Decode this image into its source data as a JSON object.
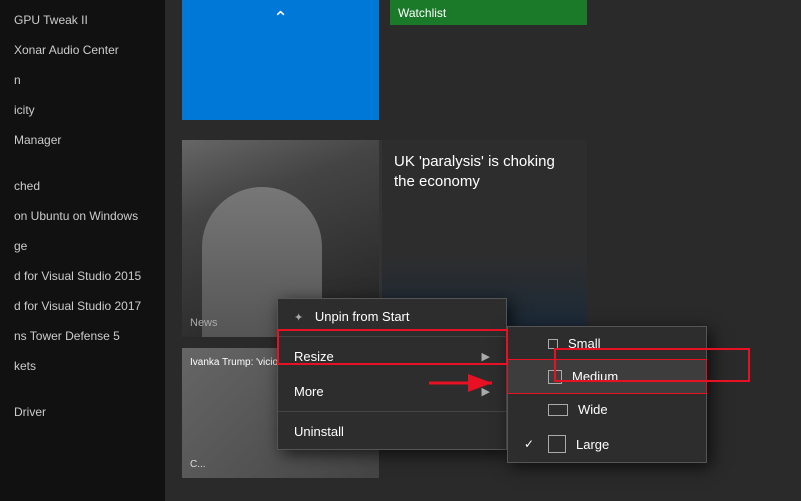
{
  "sidebar": {
    "items": [
      {
        "label": "GPU Tweak II"
      },
      {
        "label": "Xonar Audio Center"
      },
      {
        "label": "n"
      },
      {
        "label": "icity"
      },
      {
        "label": "Manager"
      },
      {
        "label": ""
      },
      {
        "label": "ched"
      },
      {
        "label": "on Ubuntu on Windows"
      },
      {
        "label": "ge"
      },
      {
        "label": "d for Visual Studio 2015"
      },
      {
        "label": "d for Visual Studio 2017"
      },
      {
        "label": "ns Tower Defense 5"
      },
      {
        "label": "kets"
      },
      {
        "label": ""
      },
      {
        "label": "Driver"
      }
    ]
  },
  "tiles": {
    "watchlist": "Watchlist",
    "news_headline": "UK 'paralysis' is choking the economy",
    "news_label": "News",
    "news2_text": "Ivanka Trump: 'viciousness tha...",
    "news2_label": "C..."
  },
  "context_menu": {
    "unpin_label": "Unpin from Start",
    "resize_label": "Resize",
    "more_label": "More",
    "uninstall_label": "Uninstall"
  },
  "resize_submenu": {
    "small_label": "Small",
    "medium_label": "Medium",
    "wide_label": "Wide",
    "large_label": "Large"
  },
  "colors": {
    "accent": "#0078d7",
    "danger": "#e81123",
    "bg_dark": "#1a1a1a",
    "bg_medium": "#2d2d2d"
  }
}
